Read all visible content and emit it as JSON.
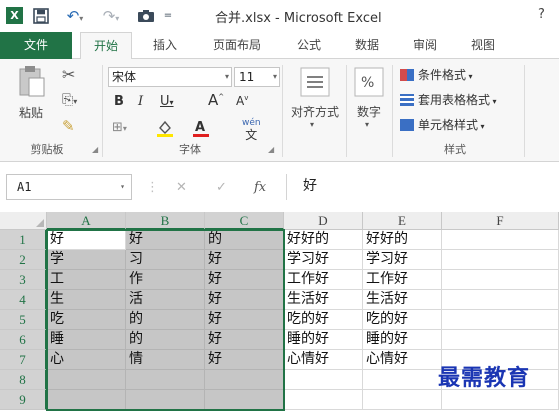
{
  "app": {
    "logo": "X",
    "title": "合并.xlsx - Microsoft Excel",
    "help": "?",
    "accent": "#217346"
  },
  "quick_access": [
    "save-icon",
    "undo-icon",
    "redo-icon",
    "camera-icon",
    "customize-icon"
  ],
  "tabs": [
    {
      "label": "文件"
    },
    {
      "label": "开始"
    },
    {
      "label": "插入"
    },
    {
      "label": "页面布局"
    },
    {
      "label": "公式"
    },
    {
      "label": "数据"
    },
    {
      "label": "审阅"
    },
    {
      "label": "视图"
    }
  ],
  "ribbon": {
    "clipboard": {
      "paste_label": "粘贴",
      "group_label": "剪贴板"
    },
    "font": {
      "name": "宋体",
      "size": "11",
      "group_label": "字体",
      "phonetic_label": "wén"
    },
    "alignment": {
      "label": "对齐方式"
    },
    "number": {
      "symbol": "%",
      "label": "数字"
    },
    "styles": {
      "conditional": "条件格式",
      "table": "套用表格格式",
      "cell": "单元格样式",
      "group_label": "样式"
    }
  },
  "formula_bar": {
    "name_box": "A1",
    "fx": "fx",
    "value": "好"
  },
  "sheet": {
    "columns": [
      "A",
      "B",
      "C",
      "D",
      "E",
      "F"
    ],
    "rows": [
      "1",
      "2",
      "3",
      "4",
      "5",
      "6",
      "7",
      "8",
      "9"
    ],
    "cells": [
      [
        "好",
        "好",
        "的",
        "好好的",
        "好好的",
        ""
      ],
      [
        "学",
        "习",
        "好",
        "学习好",
        "学习好",
        ""
      ],
      [
        "工",
        "作",
        "好",
        "工作好",
        "工作好",
        ""
      ],
      [
        "生",
        "活",
        "好",
        "生活好",
        "生活好",
        ""
      ],
      [
        "吃",
        "的",
        "好",
        "吃的好",
        "吃的好",
        ""
      ],
      [
        "睡",
        "的",
        "好",
        "睡的好",
        "睡的好",
        ""
      ],
      [
        "心",
        "情",
        "好",
        "心情好",
        "心情好",
        ""
      ],
      [
        "",
        "",
        "",
        "",
        "",
        ""
      ],
      [
        "",
        "",
        "",
        "",
        "",
        ""
      ]
    ],
    "selection": "A1:C9",
    "active_cell": "A1"
  },
  "watermark": "最需教育"
}
